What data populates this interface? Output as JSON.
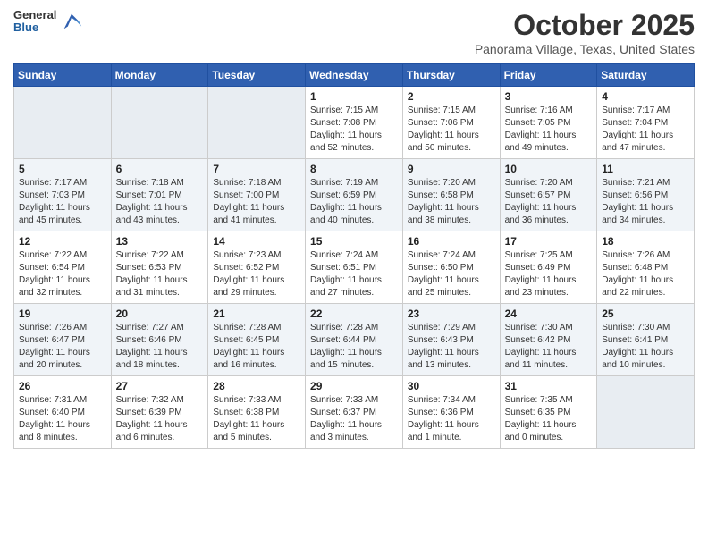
{
  "header": {
    "logo_general": "General",
    "logo_blue": "Blue",
    "month_title": "October 2025",
    "location": "Panorama Village, Texas, United States"
  },
  "weekdays": [
    "Sunday",
    "Monday",
    "Tuesday",
    "Wednesday",
    "Thursday",
    "Friday",
    "Saturday"
  ],
  "weeks": [
    [
      {
        "day": "",
        "sunrise": "",
        "sunset": "",
        "daylight": ""
      },
      {
        "day": "",
        "sunrise": "",
        "sunset": "",
        "daylight": ""
      },
      {
        "day": "",
        "sunrise": "",
        "sunset": "",
        "daylight": ""
      },
      {
        "day": "1",
        "sunrise": "Sunrise: 7:15 AM",
        "sunset": "Sunset: 7:08 PM",
        "daylight": "Daylight: 11 hours and 52 minutes."
      },
      {
        "day": "2",
        "sunrise": "Sunrise: 7:15 AM",
        "sunset": "Sunset: 7:06 PM",
        "daylight": "Daylight: 11 hours and 50 minutes."
      },
      {
        "day": "3",
        "sunrise": "Sunrise: 7:16 AM",
        "sunset": "Sunset: 7:05 PM",
        "daylight": "Daylight: 11 hours and 49 minutes."
      },
      {
        "day": "4",
        "sunrise": "Sunrise: 7:17 AM",
        "sunset": "Sunset: 7:04 PM",
        "daylight": "Daylight: 11 hours and 47 minutes."
      }
    ],
    [
      {
        "day": "5",
        "sunrise": "Sunrise: 7:17 AM",
        "sunset": "Sunset: 7:03 PM",
        "daylight": "Daylight: 11 hours and 45 minutes."
      },
      {
        "day": "6",
        "sunrise": "Sunrise: 7:18 AM",
        "sunset": "Sunset: 7:01 PM",
        "daylight": "Daylight: 11 hours and 43 minutes."
      },
      {
        "day": "7",
        "sunrise": "Sunrise: 7:18 AM",
        "sunset": "Sunset: 7:00 PM",
        "daylight": "Daylight: 11 hours and 41 minutes."
      },
      {
        "day": "8",
        "sunrise": "Sunrise: 7:19 AM",
        "sunset": "Sunset: 6:59 PM",
        "daylight": "Daylight: 11 hours and 40 minutes."
      },
      {
        "day": "9",
        "sunrise": "Sunrise: 7:20 AM",
        "sunset": "Sunset: 6:58 PM",
        "daylight": "Daylight: 11 hours and 38 minutes."
      },
      {
        "day": "10",
        "sunrise": "Sunrise: 7:20 AM",
        "sunset": "Sunset: 6:57 PM",
        "daylight": "Daylight: 11 hours and 36 minutes."
      },
      {
        "day": "11",
        "sunrise": "Sunrise: 7:21 AM",
        "sunset": "Sunset: 6:56 PM",
        "daylight": "Daylight: 11 hours and 34 minutes."
      }
    ],
    [
      {
        "day": "12",
        "sunrise": "Sunrise: 7:22 AM",
        "sunset": "Sunset: 6:54 PM",
        "daylight": "Daylight: 11 hours and 32 minutes."
      },
      {
        "day": "13",
        "sunrise": "Sunrise: 7:22 AM",
        "sunset": "Sunset: 6:53 PM",
        "daylight": "Daylight: 11 hours and 31 minutes."
      },
      {
        "day": "14",
        "sunrise": "Sunrise: 7:23 AM",
        "sunset": "Sunset: 6:52 PM",
        "daylight": "Daylight: 11 hours and 29 minutes."
      },
      {
        "day": "15",
        "sunrise": "Sunrise: 7:24 AM",
        "sunset": "Sunset: 6:51 PM",
        "daylight": "Daylight: 11 hours and 27 minutes."
      },
      {
        "day": "16",
        "sunrise": "Sunrise: 7:24 AM",
        "sunset": "Sunset: 6:50 PM",
        "daylight": "Daylight: 11 hours and 25 minutes."
      },
      {
        "day": "17",
        "sunrise": "Sunrise: 7:25 AM",
        "sunset": "Sunset: 6:49 PM",
        "daylight": "Daylight: 11 hours and 23 minutes."
      },
      {
        "day": "18",
        "sunrise": "Sunrise: 7:26 AM",
        "sunset": "Sunset: 6:48 PM",
        "daylight": "Daylight: 11 hours and 22 minutes."
      }
    ],
    [
      {
        "day": "19",
        "sunrise": "Sunrise: 7:26 AM",
        "sunset": "Sunset: 6:47 PM",
        "daylight": "Daylight: 11 hours and 20 minutes."
      },
      {
        "day": "20",
        "sunrise": "Sunrise: 7:27 AM",
        "sunset": "Sunset: 6:46 PM",
        "daylight": "Daylight: 11 hours and 18 minutes."
      },
      {
        "day": "21",
        "sunrise": "Sunrise: 7:28 AM",
        "sunset": "Sunset: 6:45 PM",
        "daylight": "Daylight: 11 hours and 16 minutes."
      },
      {
        "day": "22",
        "sunrise": "Sunrise: 7:28 AM",
        "sunset": "Sunset: 6:44 PM",
        "daylight": "Daylight: 11 hours and 15 minutes."
      },
      {
        "day": "23",
        "sunrise": "Sunrise: 7:29 AM",
        "sunset": "Sunset: 6:43 PM",
        "daylight": "Daylight: 11 hours and 13 minutes."
      },
      {
        "day": "24",
        "sunrise": "Sunrise: 7:30 AM",
        "sunset": "Sunset: 6:42 PM",
        "daylight": "Daylight: 11 hours and 11 minutes."
      },
      {
        "day": "25",
        "sunrise": "Sunrise: 7:30 AM",
        "sunset": "Sunset: 6:41 PM",
        "daylight": "Daylight: 11 hours and 10 minutes."
      }
    ],
    [
      {
        "day": "26",
        "sunrise": "Sunrise: 7:31 AM",
        "sunset": "Sunset: 6:40 PM",
        "daylight": "Daylight: 11 hours and 8 minutes."
      },
      {
        "day": "27",
        "sunrise": "Sunrise: 7:32 AM",
        "sunset": "Sunset: 6:39 PM",
        "daylight": "Daylight: 11 hours and 6 minutes."
      },
      {
        "day": "28",
        "sunrise": "Sunrise: 7:33 AM",
        "sunset": "Sunset: 6:38 PM",
        "daylight": "Daylight: 11 hours and 5 minutes."
      },
      {
        "day": "29",
        "sunrise": "Sunrise: 7:33 AM",
        "sunset": "Sunset: 6:37 PM",
        "daylight": "Daylight: 11 hours and 3 minutes."
      },
      {
        "day": "30",
        "sunrise": "Sunrise: 7:34 AM",
        "sunset": "Sunset: 6:36 PM",
        "daylight": "Daylight: 11 hours and 1 minute."
      },
      {
        "day": "31",
        "sunrise": "Sunrise: 7:35 AM",
        "sunset": "Sunset: 6:35 PM",
        "daylight": "Daylight: 11 hours and 0 minutes."
      },
      {
        "day": "",
        "sunrise": "",
        "sunset": "",
        "daylight": ""
      }
    ]
  ]
}
